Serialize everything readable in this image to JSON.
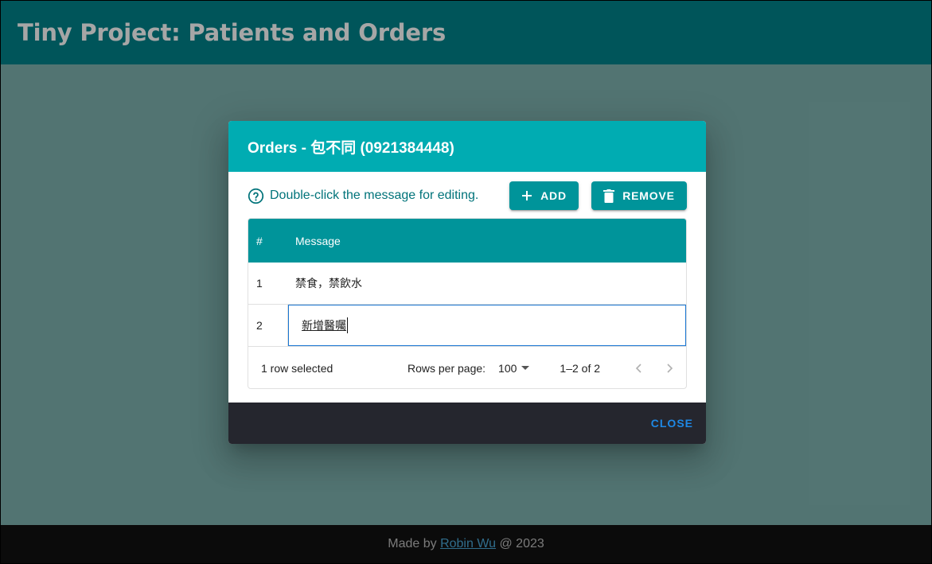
{
  "app": {
    "title": "Tiny Project: Patients and Orders"
  },
  "footer": {
    "prefix": "Made by ",
    "author": "Robin Wu",
    "suffix": " @ 2023"
  },
  "dialog": {
    "title": "Orders - 包不同 (0921384448)",
    "hint": "Double-click the message for editing.",
    "add_label": "ADD",
    "remove_label": "REMOVE",
    "close_label": "CLOSE",
    "columns": [
      "#",
      "Message"
    ],
    "rows": [
      {
        "num": "1",
        "message": "禁食，禁飲水"
      },
      {
        "num": "2",
        "message": "新增醫囑",
        "editing": true
      }
    ],
    "pagination": {
      "selected_text": "1 row selected",
      "rows_per_page_label": "Rows per page:",
      "rows_per_page": "100",
      "range": "1–2 of 2"
    }
  },
  "colors": {
    "appbar": "#00838a",
    "dialog_header": "#00acb2",
    "button": "#00949a",
    "actions_bar": "#25262e",
    "close_text": "#1e88e5",
    "hint_text": "#00737a"
  },
  "icons": [
    "help-circle-icon",
    "plus-icon",
    "trash-icon",
    "dropdown-arrow-icon",
    "chevron-left-icon",
    "chevron-right-icon"
  ]
}
